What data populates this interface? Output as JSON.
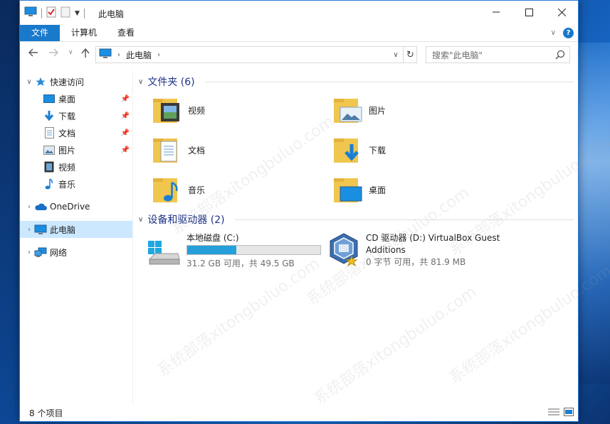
{
  "window": {
    "title": "此电脑"
  },
  "ribbon": {
    "tabs": [
      "文件",
      "计算机",
      "查看"
    ]
  },
  "address": {
    "crumbs": [
      "此电脑"
    ]
  },
  "search": {
    "placeholder": "搜索\"此电脑\""
  },
  "nav": {
    "quick_access": "快速访问",
    "quick_items": [
      "桌面",
      "下载",
      "文档",
      "图片",
      "视频",
      "音乐"
    ],
    "onedrive": "OneDrive",
    "this_pc": "此电脑",
    "network": "网络"
  },
  "content": {
    "folders_header": "文件夹 (6)",
    "folders": [
      "视频",
      "图片",
      "文档",
      "下载",
      "音乐",
      "桌面"
    ],
    "devices_header": "设备和驱动器 (2)",
    "drives": [
      {
        "name": "本地磁盘 (C:)",
        "meta": "31.2 GB 可用，共 49.5 GB",
        "used_fraction": 0.37
      },
      {
        "name_line1": "CD 驱动器 (D:) VirtualBox Guest",
        "name_line2": "Additions",
        "meta": "0 字节 可用，共 81.9 MB"
      }
    ]
  },
  "status": {
    "count": "8 个项目"
  },
  "watermark": "系统部落xitongbuluo.com",
  "colors": {
    "accent": "#1979ca",
    "selected": "#cce8ff",
    "header_text": "#1e3287",
    "bar_fill": "#26a0da"
  }
}
